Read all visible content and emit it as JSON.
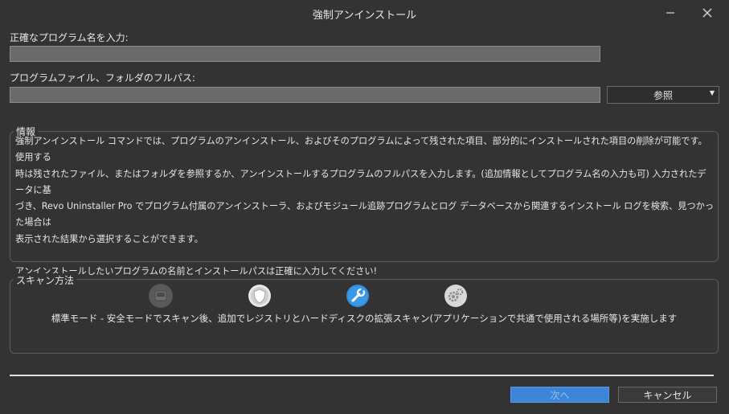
{
  "window": {
    "title": "強制アンインストール",
    "minimize_icon": "minimize-icon",
    "close_icon": "close-icon"
  },
  "program_name": {
    "label": "正確なプログラム名を入力:",
    "value": ""
  },
  "program_path": {
    "label": "プログラムファイル、フォルダのフルパス:",
    "value": "",
    "browse_label": "参照",
    "browse_icon": "dropdown-arrow-icon"
  },
  "info": {
    "legend": "情報",
    "lines": [
      "強制アンインストール コマンドでは、プログラムのアンインストール、およびそのプログラムによって残された項目、部分的にインストールされた項目の削除が可能です。使用する",
      "時は残されたファイル、またはフォルダを参照するか、アンインストールするプログラムのフルパスを入力します。(追加情報としてプログラム名の入力も可) 入力されたデータに基",
      "づき、Revo Uninstaller Pro でプログラム付属のアンインストーラ、およびモジュール追跡プログラムとログ データベースから関連するインストール ログを検索、見つかった場合は",
      "表示された結果から選択することができます。",
      "",
      "アンインストールしたいプログラムの名前とインストールパスは正確に入力してください!"
    ]
  },
  "scan": {
    "legend": "スキャン方法",
    "modes": [
      {
        "icon": "builtin-mode-icon",
        "color": "#5a5a5a"
      },
      {
        "icon": "safe-mode-shield-icon",
        "color": "#e8e8e8"
      },
      {
        "icon": "moderate-mode-wrench-icon",
        "color": "#2f8fdf"
      },
      {
        "icon": "advanced-mode-gears-icon",
        "color": "#d8d8d8"
      }
    ],
    "selected_index": 2,
    "description": "標準モード - 安全モードでスキャン後、追加でレジストリとハードディスクの拡張スキャン(アプリケーションで共通で使用される場所等)を実施します"
  },
  "footer": {
    "next_label": "次へ",
    "cancel_label": "キャンセル",
    "accent": "#3d85d8"
  }
}
